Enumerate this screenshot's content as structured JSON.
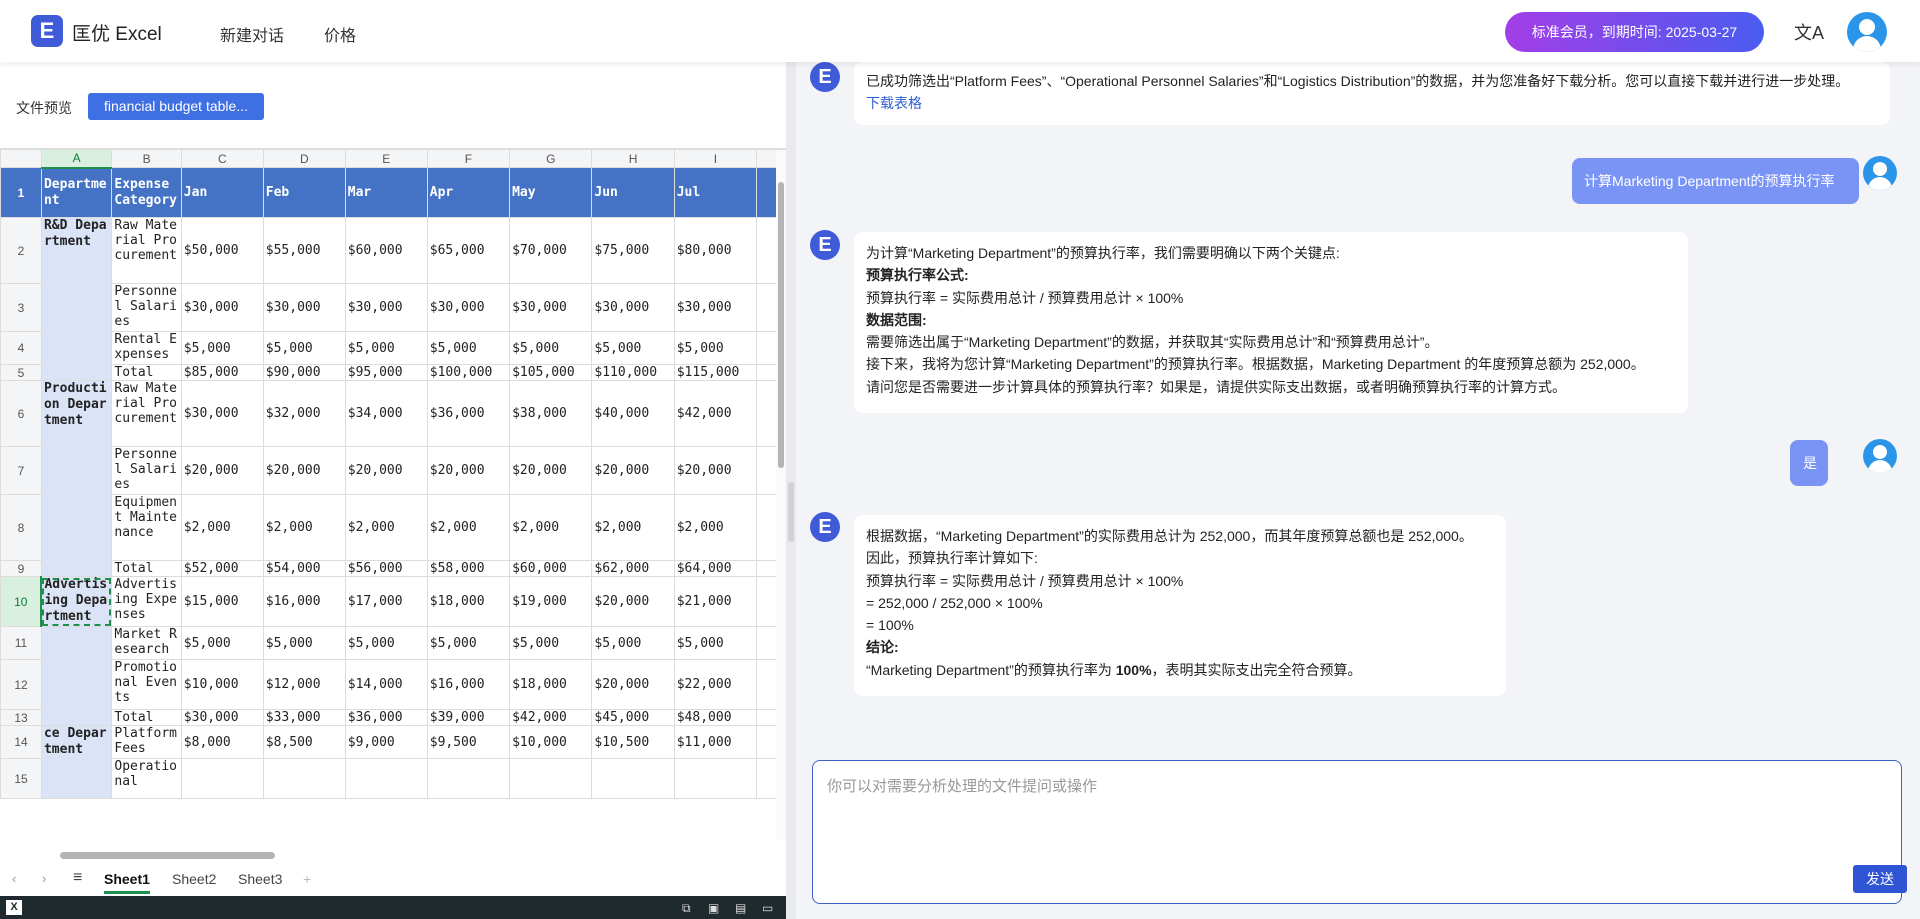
{
  "app": {
    "logo_glyph": "E",
    "name": "匡优 Excel"
  },
  "nav": {
    "new_chat": "新建对话",
    "pricing": "价格"
  },
  "membership": "标准会员，到期时间: 2025-03-27",
  "lang_icon_glyph": "文A",
  "preview": {
    "label": "文件预览",
    "file_chip": "financial budget table..."
  },
  "sheet": {
    "col_headers": [
      "A",
      "B",
      "C",
      "D",
      "E",
      "F",
      "G",
      "H",
      "I"
    ],
    "header_row": [
      "Department",
      "Expense Category",
      "Jan",
      "Feb",
      "Mar",
      "Apr",
      "May",
      "Jun",
      "Jul"
    ],
    "rows": [
      {
        "dept": "R&D Department",
        "cat": "Raw Material Procurement",
        "vals": [
          "$50,000",
          "$55,000",
          "$60,000",
          "$65,000",
          "$70,000",
          "$75,000",
          "$80,000"
        ]
      },
      {
        "cat": "Personnel Salaries",
        "vals": [
          "$30,000",
          "$30,000",
          "$30,000",
          "$30,000",
          "$30,000",
          "$30,000",
          "$30,000"
        ]
      },
      {
        "cat": "Rental Expenses",
        "vals": [
          "$5,000",
          "$5,000",
          "$5,000",
          "$5,000",
          "$5,000",
          "$5,000",
          "$5,000"
        ]
      },
      {
        "cat": "Total",
        "vals": [
          "$85,000",
          "$90,000",
          "$95,000",
          "$100,000",
          "$105,000",
          "$110,000",
          "$115,000"
        ]
      },
      {
        "dept": "Production Department",
        "cat": "Raw Material Procurement",
        "vals": [
          "$30,000",
          "$32,000",
          "$34,000",
          "$36,000",
          "$38,000",
          "$40,000",
          "$42,000"
        ]
      },
      {
        "cat": "Personnel Salaries",
        "vals": [
          "$20,000",
          "$20,000",
          "$20,000",
          "$20,000",
          "$20,000",
          "$20,000",
          "$20,000"
        ]
      },
      {
        "cat": "Equipment Maintenance",
        "vals": [
          "$2,000",
          "$2,000",
          "$2,000",
          "$2,000",
          "$2,000",
          "$2,000",
          "$2,000"
        ]
      },
      {
        "cat": "Total",
        "vals": [
          "$52,000",
          "$54,000",
          "$56,000",
          "$58,000",
          "$60,000",
          "$62,000",
          "$64,000"
        ]
      },
      {
        "dept": "Advertising Department",
        "cat": "Advertising Expenses",
        "vals": [
          "$15,000",
          "$16,000",
          "$17,000",
          "$18,000",
          "$19,000",
          "$20,000",
          "$21,000"
        ]
      },
      {
        "cat": "Market Research",
        "vals": [
          "$5,000",
          "$5,000",
          "$5,000",
          "$5,000",
          "$5,000",
          "$5,000",
          "$5,000"
        ]
      },
      {
        "cat": "Promotional Events",
        "vals": [
          "$10,000",
          "$12,000",
          "$14,000",
          "$16,000",
          "$18,000",
          "$20,000",
          "$22,000"
        ]
      },
      {
        "cat": "Total",
        "vals": [
          "$30,000",
          "$33,000",
          "$36,000",
          "$39,000",
          "$42,000",
          "$45,000",
          "$48,000"
        ]
      },
      {
        "dept": "ce Department",
        "cat": "Platform Fees",
        "vals": [
          "$8,000",
          "$8,500",
          "$9,000",
          "$9,500",
          "$10,000",
          "$10,500",
          "$11,000"
        ]
      },
      {
        "cat": "Operational",
        "vals": [
          "",
          "",
          "",
          "",
          "",
          "",
          ""
        ]
      }
    ],
    "tabs": [
      "Sheet1",
      "Sheet2",
      "Sheet3"
    ],
    "add_tab": "+",
    "status_glyph": "X"
  },
  "chat": {
    "bot_glyph": "E",
    "msg1": {
      "text": "已成功筛选出“Platform Fees”、“Operational Personnel Salaries”和“Logistics Distribution”的数据，并为您准备好下载分析。您可以直接下载并进行进一步处理。",
      "link": "下载表格"
    },
    "user1": "计算Marketing Department的预算执行率",
    "msg2": {
      "l1": "为计算“Marketing Department”的预算执行率，我们需要明确以下两个关键点:",
      "l2": "预算执行率公式:",
      "l3": "预算执行率 = 实际费用总计 / 预算费用总计 × 100%",
      "l4": "数据范围:",
      "l5": "需要筛选出属于“Marketing Department”的数据，并获取其“实际费用总计”和“预算费用总计”。",
      "l6": "接下来，我将为您计算“Marketing Department”的预算执行率。根据数据，Marketing Department 的年度预算总额为 252,000。",
      "l7": "请问您是否需要进一步计算具体的预算执行率？如果是，请提供实际支出数据，或者明确预算执行率的计算方式。"
    },
    "user2": "是",
    "msg3": {
      "l1": "根据数据，“Marketing Department”的实际费用总计为 252,000，而其年度预算总额也是 252,000。",
      "l2": "因此，预算执行率计算如下:",
      "l3": "预算执行率 = 实际费用总计 / 预算费用总计 × 100%",
      "l4": "= 252,000 / 252,000 × 100%",
      "l5": "= 100%",
      "l6": "结论:",
      "l7a": "“Marketing Department”的预算执行率为 ",
      "l7b": "100%",
      "l7c": "，表明其实际支出完全符合预算。"
    },
    "input_placeholder": "你可以对需要分析处理的文件提问或操作",
    "send_label": "发送"
  }
}
